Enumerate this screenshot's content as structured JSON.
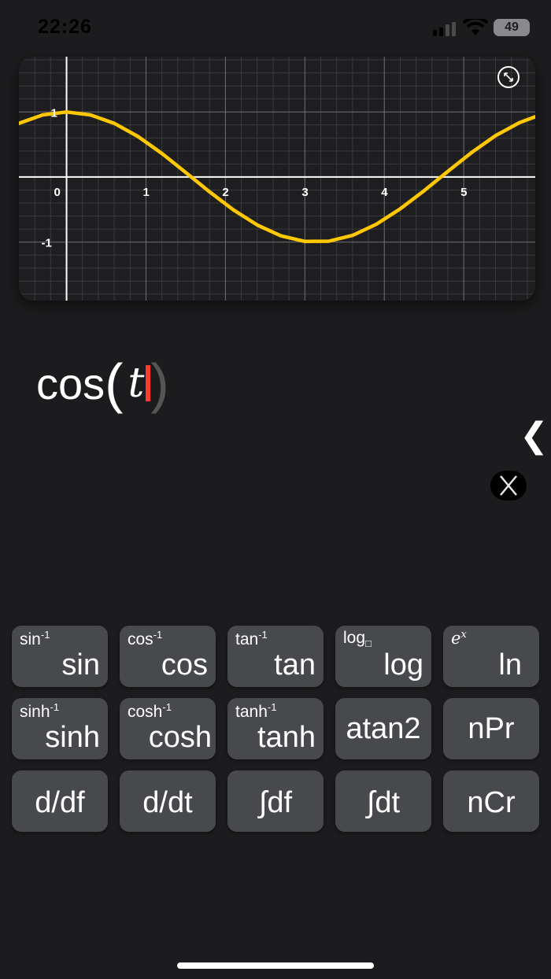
{
  "status_bar": {
    "time": "22:26",
    "battery": "49"
  },
  "expression": {
    "function": "cos",
    "open_paren": "(",
    "variable": "t",
    "close_paren": ")"
  },
  "keypad": {
    "row1": [
      {
        "sup": "sin",
        "sup_exp": "-1",
        "main": "sin"
      },
      {
        "sup": "cos",
        "sup_exp": "-1",
        "main": "cos"
      },
      {
        "sup": "tan",
        "sup_exp": "-1",
        "main": "tan"
      },
      {
        "sup": "log",
        "sup_exp": "□",
        "main": "log"
      },
      {
        "sup": "e",
        "sup_exp": "x",
        "main": "ln"
      }
    ],
    "row2": [
      {
        "sup": "sinh",
        "sup_exp": "-1",
        "main": "sinh"
      },
      {
        "sup": "cosh",
        "sup_exp": "-1",
        "main": "cosh"
      },
      {
        "sup": "tanh",
        "sup_exp": "-1",
        "main": "tanh"
      },
      {
        "main": "atan2"
      },
      {
        "main": "nPr"
      }
    ],
    "row3": [
      {
        "main": "d/df"
      },
      {
        "main": "d/dt"
      },
      {
        "main": "∫df"
      },
      {
        "main": "∫dt"
      },
      {
        "main": "nCr"
      }
    ]
  },
  "chart_data": {
    "type": "line",
    "x_ticks": [
      "0",
      "1",
      "2",
      "3",
      "4",
      "5"
    ],
    "y_ticks": [
      "1",
      "-1"
    ],
    "xlim": [
      -0.6,
      5.9
    ],
    "ylim": [
      -1.9,
      1.85
    ],
    "grid": true,
    "series_color": "#ffc800",
    "series": [
      {
        "x": [
          -0.6,
          -0.3,
          0,
          0.3,
          0.6,
          0.9,
          1.2,
          1.5,
          1.8,
          2.1,
          2.4,
          2.7,
          3.0,
          3.3,
          3.6,
          3.9,
          4.2,
          4.5,
          4.8,
          5.1,
          5.4,
          5.7,
          5.9
        ],
        "y": [
          0.825,
          0.955,
          1.0,
          0.955,
          0.825,
          0.622,
          0.362,
          0.071,
          -0.227,
          -0.505,
          -0.737,
          -0.904,
          -0.99,
          -0.987,
          -0.897,
          -0.726,
          -0.49,
          -0.211,
          0.087,
          0.378,
          0.635,
          0.835,
          0.927
        ]
      }
    ]
  }
}
